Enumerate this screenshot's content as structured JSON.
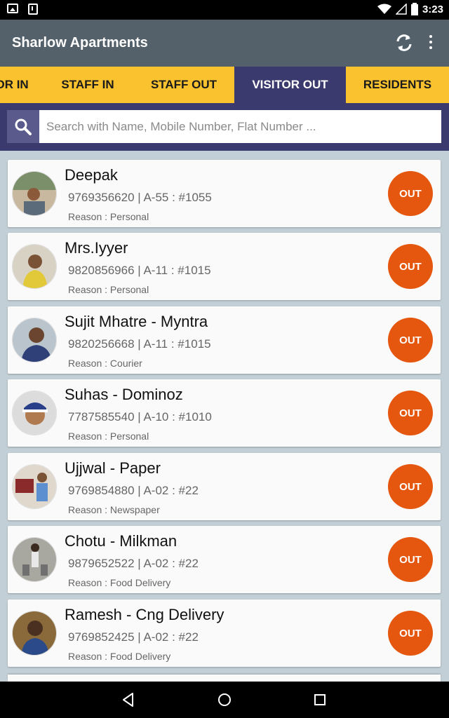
{
  "status_bar": {
    "time": "3:23",
    "icons": [
      "image-icon",
      "download-icon",
      "wifi-icon",
      "signal-icon",
      "battery-icon"
    ]
  },
  "app_bar": {
    "title": "Sharlow Apartments",
    "actions": [
      "refresh-icon",
      "more-vert-icon"
    ]
  },
  "tabs": [
    {
      "label": "VISITOR IN"
    },
    {
      "label": "STAFF IN"
    },
    {
      "label": "STAFF OUT"
    },
    {
      "label": "VISITOR OUT",
      "active": true
    },
    {
      "label": "RESIDENTS"
    }
  ],
  "search": {
    "placeholder": "Search with Name, Mobile Number, Flat Number ..."
  },
  "visitors": [
    {
      "name": "Deepak",
      "info": "9769356620 | A-55 : #1055",
      "reason": "Reason : Personal",
      "action": "OUT"
    },
    {
      "name": "Mrs.Iyyer",
      "info": "9820856966 | A-11 : #1015",
      "reason": "Reason : Personal",
      "action": "OUT"
    },
    {
      "name": "Sujit Mhatre - Myntra",
      "info": "9820256668 | A-11 : #1015",
      "reason": "Reason : Courier",
      "action": "OUT"
    },
    {
      "name": "Suhas - Dominoz",
      "info": "7787585540 | A-10 : #1010",
      "reason": "Reason : Personal",
      "action": "OUT"
    },
    {
      "name": "Ujjwal - Paper",
      "info": "9769854880 | A-02 : #22",
      "reason": "Reason : Newspaper",
      "action": "OUT"
    },
    {
      "name": "Chotu - Milkman",
      "info": "9879652522 | A-02 : #22",
      "reason": "Reason : Food Delivery",
      "action": "OUT"
    },
    {
      "name": "Ramesh - Cng Delivery",
      "info": "9769852425 | A-02 : #22",
      "reason": "Reason : Food Delivery",
      "action": "OUT"
    }
  ],
  "colors": {
    "app_bar": "#54616a",
    "tab_bar": "#f9c22e",
    "tab_active": "#3b3a6e",
    "out_button": "#e5560e",
    "background": "#c3cfd6"
  }
}
